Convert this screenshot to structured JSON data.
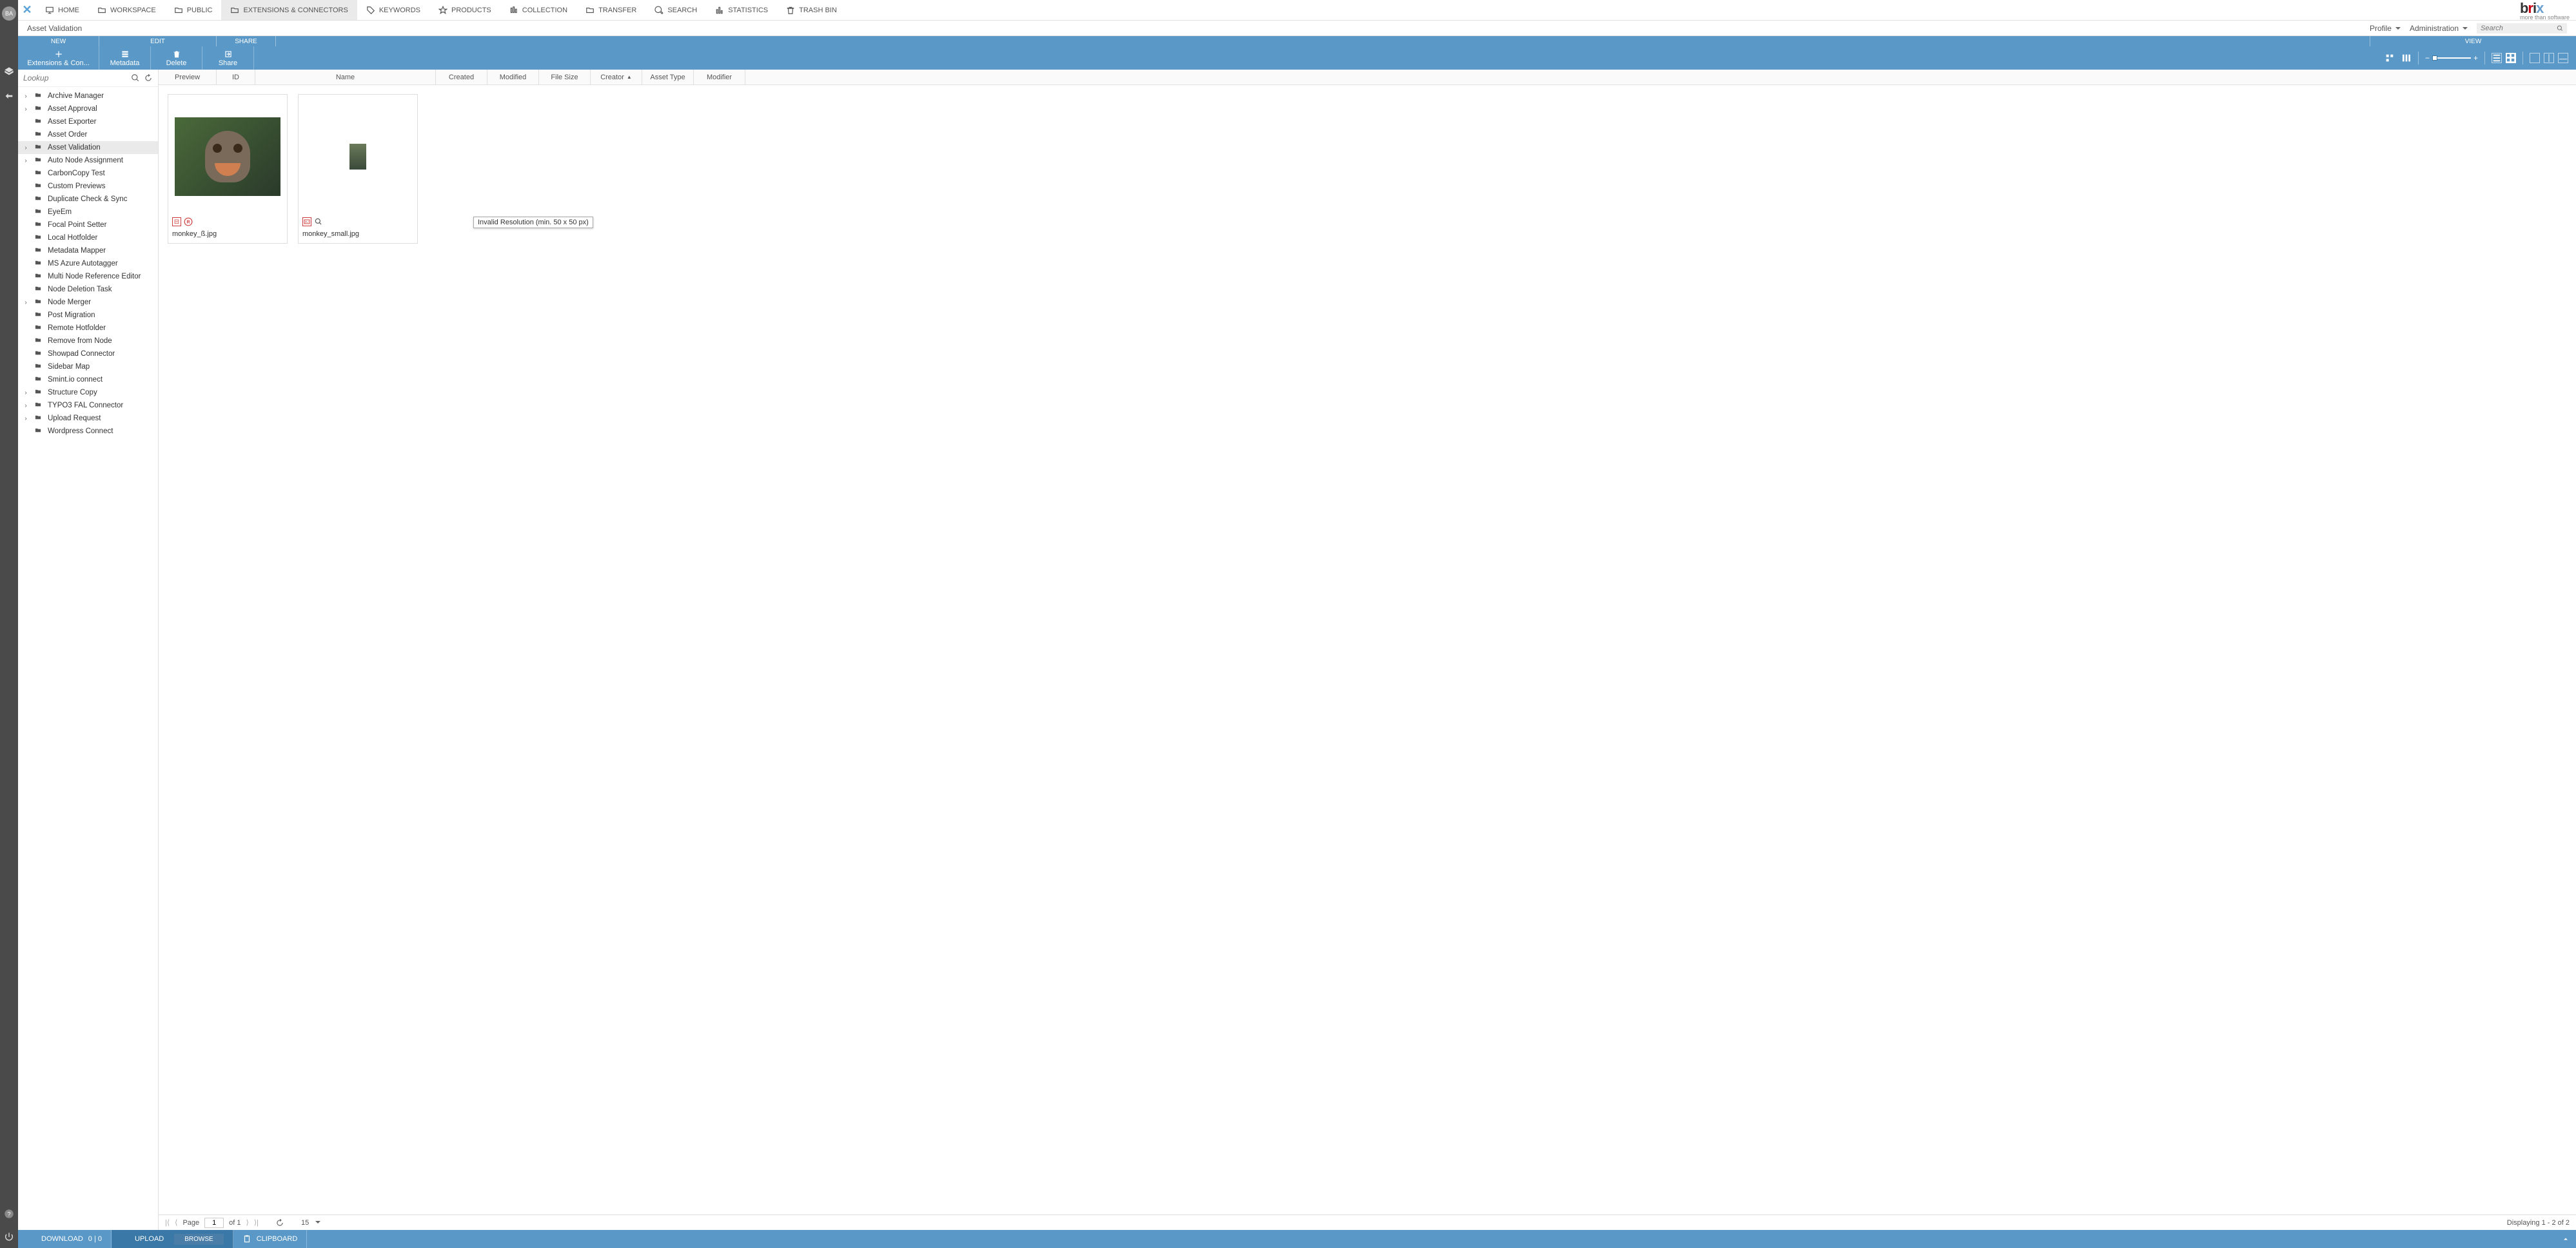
{
  "topnav": [
    {
      "label": "HOME",
      "icon": "monitor"
    },
    {
      "label": "WORKSPACE",
      "icon": "folder"
    },
    {
      "label": "PUBLIC",
      "icon": "folder"
    },
    {
      "label": "EXTENSIONS & CONNECTORS",
      "icon": "folder",
      "active": true
    },
    {
      "label": "KEYWORDS",
      "icon": "tag"
    },
    {
      "label": "PRODUCTS",
      "icon": "star"
    },
    {
      "label": "COLLECTION",
      "icon": "bars"
    },
    {
      "label": "TRANSFER",
      "icon": "folder"
    },
    {
      "label": "SEARCH",
      "icon": "search"
    },
    {
      "label": "STATISTICS",
      "icon": "stats"
    },
    {
      "label": "TRASH BIN",
      "icon": "trash"
    }
  ],
  "brand_tag": "more than software",
  "breadcrumb": "Asset Validation",
  "header_menus": {
    "profile": "Profile",
    "admin": "Administration"
  },
  "search_placeholder": "Search",
  "bluetabs": {
    "new": "NEW",
    "edit": "EDIT",
    "share": "SHARE",
    "view": "VIEW"
  },
  "toolbar": {
    "add": "Extensions & Con...",
    "metadata": "Metadata",
    "delete": "Delete",
    "share": "Share"
  },
  "lookup_placeholder": "Lookup",
  "tree": [
    {
      "label": "Archive Manager",
      "expand": true
    },
    {
      "label": "Asset Approval",
      "expand": true
    },
    {
      "label": "Asset Exporter",
      "expand": false
    },
    {
      "label": "Asset Order",
      "expand": false
    },
    {
      "label": "Asset Validation",
      "expand": true,
      "active": true
    },
    {
      "label": "Auto Node Assignment",
      "expand": true
    },
    {
      "label": "CarbonCopy Test",
      "expand": false
    },
    {
      "label": "Custom Previews",
      "expand": false
    },
    {
      "label": "Duplicate Check & Sync",
      "expand": false
    },
    {
      "label": "EyeEm",
      "expand": false
    },
    {
      "label": "Focal Point Setter",
      "expand": false
    },
    {
      "label": "Local Hotfolder",
      "expand": false
    },
    {
      "label": "Metadata Mapper",
      "expand": false
    },
    {
      "label": "MS Azure Autotagger",
      "expand": false
    },
    {
      "label": "Multi Node Reference Editor",
      "expand": false
    },
    {
      "label": "Node Deletion Task",
      "expand": false
    },
    {
      "label": "Node Merger",
      "expand": true
    },
    {
      "label": "Post Migration",
      "expand": false
    },
    {
      "label": "Remote Hotfolder",
      "expand": false
    },
    {
      "label": "Remove from Node",
      "expand": false
    },
    {
      "label": "Showpad Connector",
      "expand": false
    },
    {
      "label": "Sidebar Map",
      "expand": false
    },
    {
      "label": "Smint.io connect",
      "expand": false
    },
    {
      "label": "Structure Copy",
      "expand": true
    },
    {
      "label": "TYPO3 FAL Connector",
      "expand": true
    },
    {
      "label": "Upload Request",
      "expand": true
    },
    {
      "label": "Wordpress Connect",
      "expand": false
    }
  ],
  "columns": {
    "preview": "Preview",
    "id": "ID",
    "name": "Name",
    "created": "Created",
    "modified": "Modified",
    "filesize": "File Size",
    "creator": "Creator",
    "assettype": "Asset Type",
    "modifier": "Modifier"
  },
  "cards": [
    {
      "filename": "monkey_ß.jpg",
      "thumb": "big",
      "badges": [
        "err",
        "restr"
      ]
    },
    {
      "filename": "monkey_small.jpg",
      "thumb": "small",
      "badges": [
        "err",
        "mag"
      ]
    }
  ],
  "tooltip_text": "Invalid Resolution (min. 50 x 50 px)",
  "pager": {
    "page_label": "Page",
    "current": "1",
    "of_label": "of 1",
    "pagesize": "15",
    "displaying": "Displaying 1 - 2 of 2"
  },
  "bottombar": {
    "download": "DOWNLOAD",
    "download_count": "0 | 0",
    "upload": "UPLOAD",
    "browse": "BROWSE",
    "clipboard": "CLIPBOARD"
  },
  "rail_avatar": "BA"
}
